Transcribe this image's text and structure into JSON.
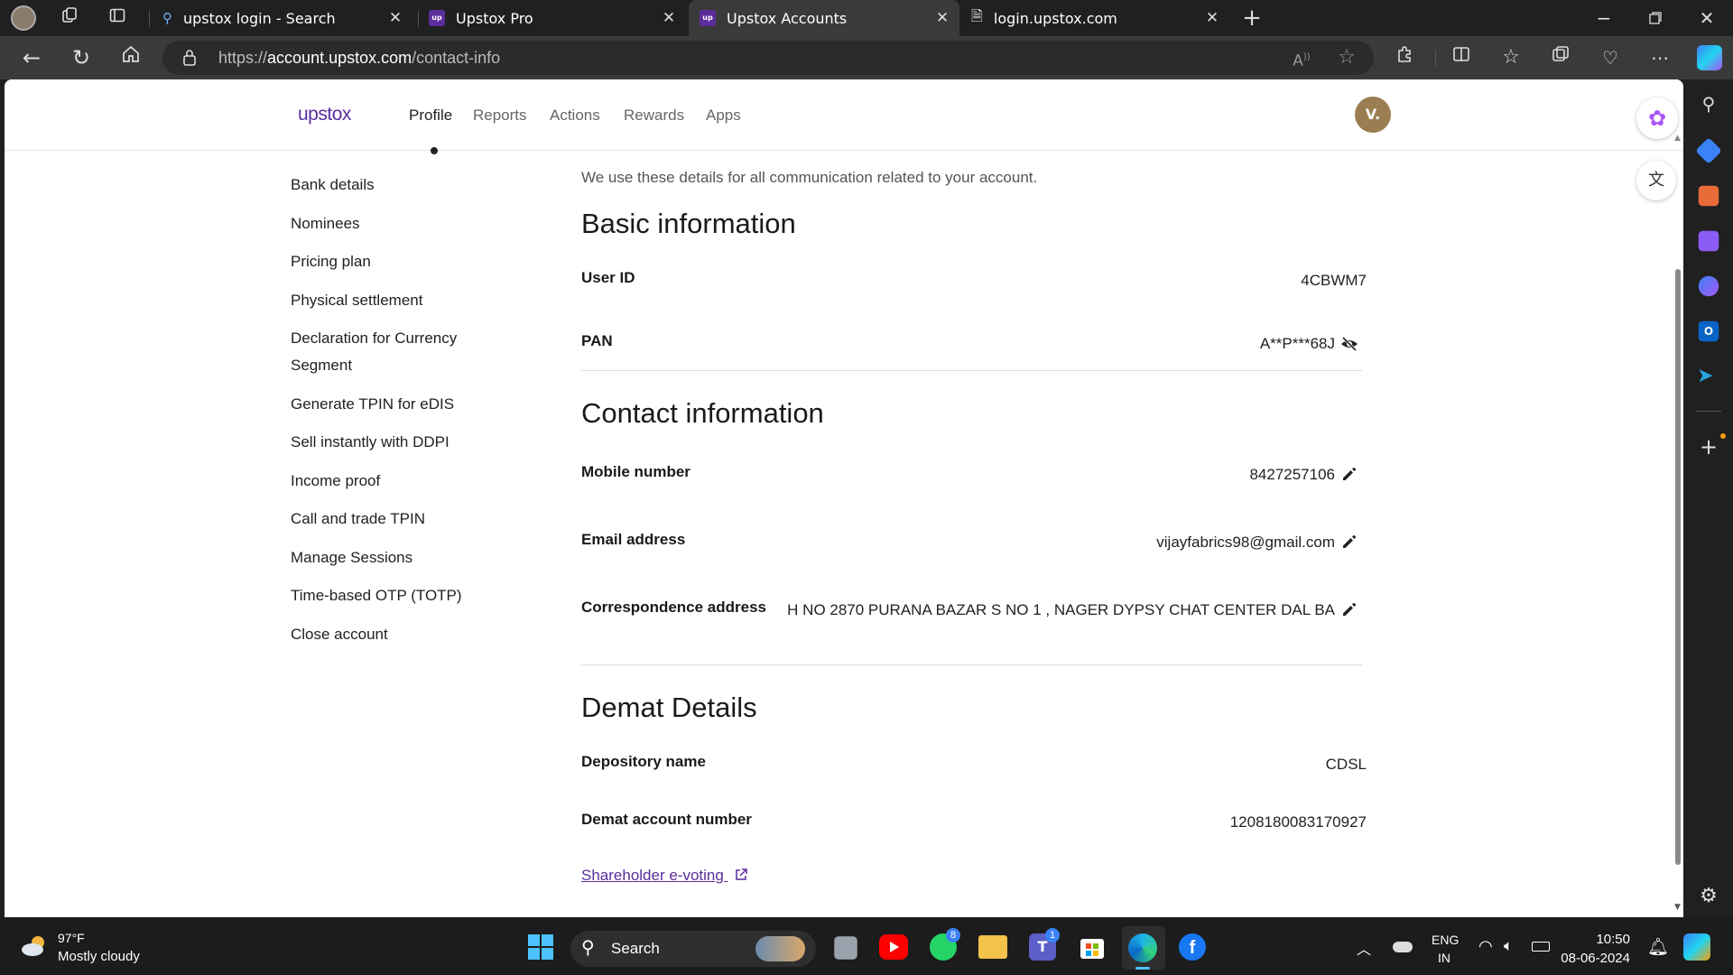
{
  "browser": {
    "tabs": [
      {
        "label": "upstox login - Search"
      },
      {
        "label": "Upstox Pro"
      },
      {
        "label": "Upstox Accounts"
      },
      {
        "label": "login.upstox.com"
      }
    ],
    "url_prefix": "https://",
    "url_domain": "account.upstox.com",
    "url_path": "/contact-info"
  },
  "header": {
    "logo": "upstox",
    "nav": [
      "Profile",
      "Reports",
      "Actions",
      "Rewards",
      "Apps"
    ],
    "active_nav": "Profile",
    "avatar": "V."
  },
  "sidebar": {
    "items": [
      "Bank details",
      "Nominees",
      "Pricing plan",
      "Physical settlement",
      "Declaration for Currency Segment",
      "Generate TPIN for eDIS",
      "Sell instantly with DDPI",
      "Income proof",
      "Call and trade TPIN",
      "Manage Sessions",
      "Time-based OTP (TOTP)",
      "Close account"
    ]
  },
  "main": {
    "intro": "We use these details for all communication related to your account.",
    "basic": {
      "title": "Basic information",
      "user_id_label": "User ID",
      "user_id": "4CBWM7",
      "pan_label": "PAN",
      "pan": "A**P***68J"
    },
    "contact": {
      "title": "Contact information",
      "mobile_label": "Mobile number",
      "mobile": "8427257106",
      "email_label": "Email address",
      "email": "vijayfabrics98@gmail.com",
      "address_label": "Correspondence address",
      "address": "H NO 2870 PURANA BAZAR S NO 1 , NAGER DYPSY CHAT CENTER DAL BA"
    },
    "demat": {
      "title": "Demat Details",
      "depository_label": "Depository name",
      "depository": "CDSL",
      "account_label": "Demat account number",
      "account": "1208180083170927",
      "evoting": "Shareholder e-voting"
    }
  },
  "taskbar": {
    "weather_temp": "97°F",
    "weather_desc": "Mostly cloudy",
    "search": "Search",
    "whatsapp_badge": "8",
    "teams_badge": "1",
    "lang1": "ENG",
    "lang2": "IN",
    "time": "10:50",
    "date": "08-06-2024"
  },
  "colors": {
    "brand": "#5a2d9c",
    "avatar": "#9b7d52"
  }
}
